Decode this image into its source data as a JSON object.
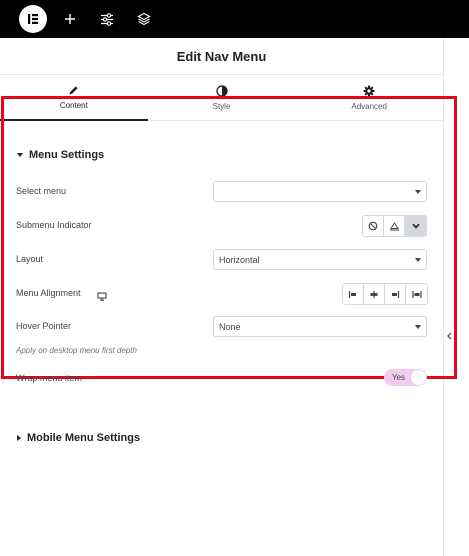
{
  "panel": {
    "title": "Edit Nav Menu"
  },
  "tabs": [
    {
      "label": "Content",
      "icon": "pencil-icon",
      "active": true
    },
    {
      "label": "Style",
      "icon": "half-circle-icon",
      "active": false
    },
    {
      "label": "Advanced",
      "icon": "gear-icon",
      "active": false
    }
  ],
  "menu_settings": {
    "title": "Menu Settings",
    "select_menu": {
      "label": "Select menu",
      "value": ""
    },
    "submenu_indicator": {
      "label": "Submenu Indicator",
      "options": [
        "none-icon",
        "classic-icon",
        "chevron-down-icon"
      ],
      "selected": "chevron-down-icon"
    },
    "layout": {
      "label": "Layout",
      "value": "Horizontal"
    },
    "menu_alignment": {
      "label": "Menu Alignment",
      "device_icon": "desktop-icon",
      "options": [
        "align-start-icon",
        "align-center-icon",
        "align-end-icon",
        "align-justify-icon"
      ]
    },
    "hover_pointer": {
      "label": "Hover Pointer",
      "value": "None",
      "hint": "Apply on desktop menu first depth"
    },
    "wrap_menu_item": {
      "label": "Wrap menu item",
      "value": "Yes",
      "enabled": true
    }
  },
  "mobile_menu_settings": {
    "title": "Mobile Menu Settings"
  },
  "colors": {
    "highlight_border": "#e2081c",
    "toggle_on": "#f2ccf0",
    "topbar": "#000000"
  }
}
